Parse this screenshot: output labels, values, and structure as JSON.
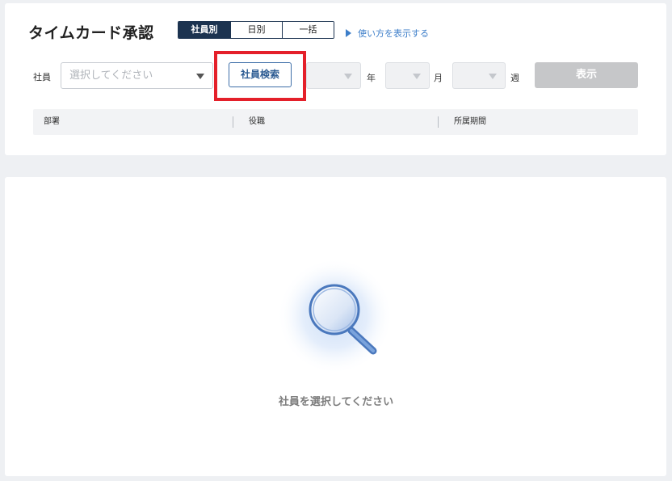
{
  "header": {
    "title": "タイムカード承認",
    "view_tabs": [
      {
        "label": "社員別",
        "active": true
      },
      {
        "label": "日別",
        "active": false
      },
      {
        "label": "一括",
        "active": false
      }
    ],
    "howto_label": "使い方を表示する"
  },
  "filters": {
    "employee_label": "社員",
    "employee_placeholder": "選択してください",
    "employee_search_button": "社員検索",
    "year_label": "年",
    "month_label": "月",
    "week_label": "週",
    "show_button": "表示"
  },
  "info_bar": {
    "department": "部署",
    "position": "役職",
    "period": "所属期間"
  },
  "empty_state": {
    "message": "社員を選択してください"
  },
  "colors": {
    "accent": "#1c3350",
    "link": "#3d7ec9",
    "highlight": "#e4202a",
    "disabled_button": "#c6c7c9"
  }
}
